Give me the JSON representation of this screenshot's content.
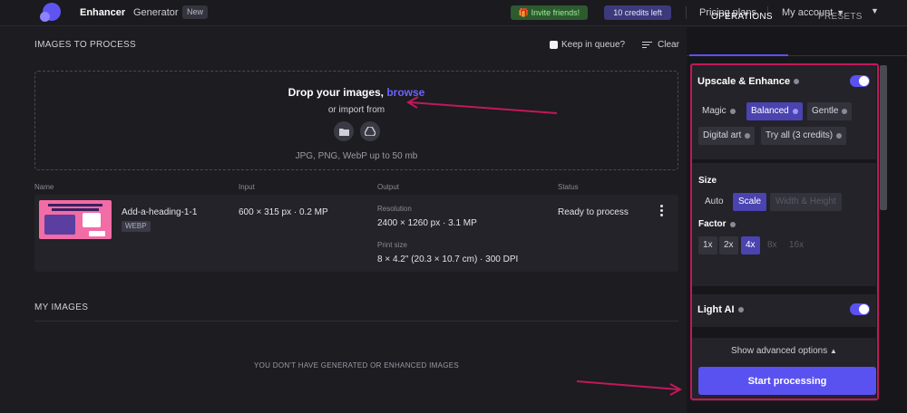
{
  "nav": {
    "brand": "Enhancer",
    "generator": "Generator",
    "new_badge": "New",
    "invite": "🎁 Invite friends!",
    "credits": "10 credits left",
    "pricing": "Pricing plans",
    "account": "My account"
  },
  "process": {
    "title": "IMAGES TO PROCESS",
    "keep_in_queue": "Keep in queue?",
    "clear": "Clear"
  },
  "dropzone": {
    "title": "Drop your images,",
    "browse": "browse",
    "import_from": "or import from",
    "formats": "JPG, PNG, WebP up to 50 mb",
    "import_icons": [
      "folder-icon",
      "google-drive-icon"
    ]
  },
  "table": {
    "columns": [
      "Name",
      "Input",
      "Output",
      "Status"
    ],
    "row": {
      "name": "Add-a-heading-1-1",
      "type": "WEBP",
      "input": "600 × 315 px · 0.2 MP",
      "resolution_label": "Resolution",
      "resolution": "2400 × 1260 px · 3.1 MP",
      "print_label": "Print size",
      "print_size": "8 × 4.2\" (20.3 × 10.7 cm) · 300 DPI",
      "status": "Ready to process"
    }
  },
  "my_images": {
    "title": "MY IMAGES",
    "empty": "YOU DON'T HAVE GENERATED OR ENHANCED IMAGES"
  },
  "panel": {
    "tabs": [
      "OPERATIONS",
      "PRESETS"
    ],
    "active_tab": "OPERATIONS",
    "upscale": {
      "title": "Upscale & Enhance",
      "enabled": true,
      "modes": [
        "Magic",
        "Balanced",
        "Gentle",
        "Digital art",
        "Try all (3 credits)"
      ],
      "selected_mode": "Balanced"
    },
    "size": {
      "label": "Size",
      "options": [
        "Auto",
        "Scale",
        "Width & Height"
      ],
      "selected": "Scale"
    },
    "factor": {
      "label": "Factor",
      "options": [
        "1x",
        "2x",
        "4x",
        "8x",
        "16x"
      ],
      "selected": "4x"
    },
    "light_ai": {
      "title": "Light AI",
      "enabled": true
    },
    "advanced": "Show advanced options",
    "start": "Start processing"
  },
  "colors": {
    "accent": "#5a52f0",
    "annotation": "#c2185b"
  }
}
